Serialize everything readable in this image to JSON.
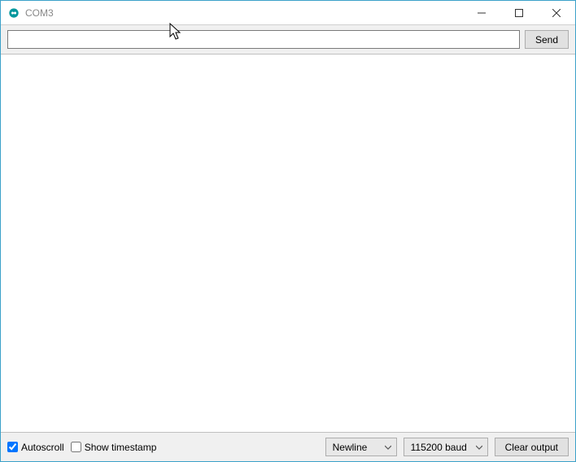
{
  "window": {
    "title": "COM3"
  },
  "toolbar": {
    "send_label": "Send"
  },
  "input": {
    "value": ""
  },
  "footer": {
    "autoscroll_label": "Autoscroll",
    "autoscroll_checked": true,
    "timestamp_label": "Show timestamp",
    "timestamp_checked": false,
    "line_ending_selected": "Newline",
    "baud_selected": "115200 baud",
    "clear_label": "Clear output"
  }
}
